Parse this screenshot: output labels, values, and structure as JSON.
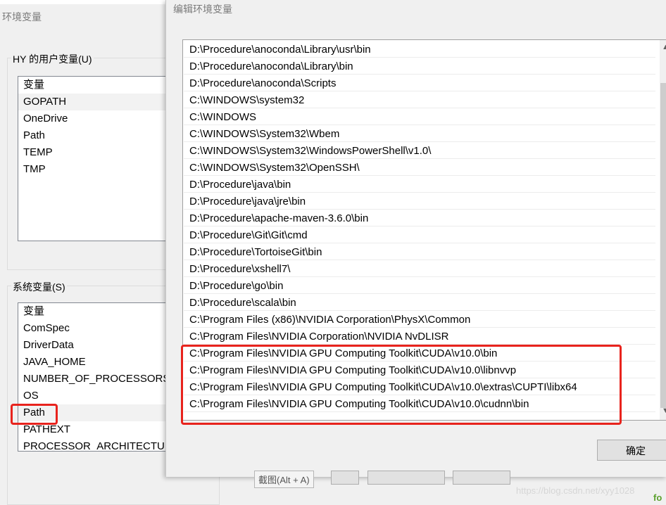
{
  "bg_window": {
    "title": "环境变量",
    "user_group_label": "HY 的用户变量(U)",
    "user_list": {
      "header": "变量",
      "items": [
        "GOPATH",
        "OneDrive",
        "Path",
        "TEMP",
        "TMP"
      ]
    },
    "sys_group_label": "系统变量(S)",
    "sys_list": {
      "header": "变量",
      "items": [
        "ComSpec",
        "DriverData",
        "JAVA_HOME",
        "NUMBER_OF_PROCESSORS",
        "OS",
        "Path",
        "PATHEXT",
        "PROCESSOR_ARCHITECTURE"
      ]
    }
  },
  "dialog": {
    "title": "编辑环境变量",
    "paths": [
      "D:\\Procedure\\anoconda\\Library\\usr\\bin",
      "D:\\Procedure\\anoconda\\Library\\bin",
      "D:\\Procedure\\anoconda\\Scripts",
      "C:\\WINDOWS\\system32",
      "C:\\WINDOWS",
      "C:\\WINDOWS\\System32\\Wbem",
      "C:\\WINDOWS\\System32\\WindowsPowerShell\\v1.0\\",
      "C:\\WINDOWS\\System32\\OpenSSH\\",
      "D:\\Procedure\\java\\bin",
      "D:\\Procedure\\java\\jre\\bin",
      "D:\\Procedure\\apache-maven-3.6.0\\bin",
      "D:\\Procedure\\Git\\Git\\cmd",
      "D:\\Procedure\\TortoiseGit\\bin",
      "D:\\Procedure\\xshell7\\",
      "D:\\Procedure\\go\\bin",
      "D:\\Procedure\\scala\\bin",
      "C:\\Program Files (x86)\\NVIDIA Corporation\\PhysX\\Common",
      "C:\\Program Files\\NVIDIA Corporation\\NVIDIA NvDLISR",
      "C:\\Program Files\\NVIDIA GPU Computing Toolkit\\CUDA\\v10.0\\bin",
      "C:\\Program Files\\NVIDIA GPU Computing Toolkit\\CUDA\\v10.0\\libnvvp",
      "C:\\Program Files\\NVIDIA GPU Computing Toolkit\\CUDA\\v10.0\\extras\\CUPTI\\libx64",
      "C:\\Program Files\\NVIDIA GPU Computing Toolkit\\CUDA\\v10.0\\cudnn\\bin"
    ],
    "ok_label": "确定",
    "scroll_up_icon": "chevron-up-icon",
    "scroll_down_icon": "chevron-down-icon"
  },
  "overlay": {
    "screenshot_tip": "截图(Alt + A)",
    "watermark": "https://blog.csdn.net/xyy1028",
    "edge_text": "fo"
  },
  "colors": {
    "highlight": "#e8231d",
    "selected_row": "#f2f2f2"
  }
}
